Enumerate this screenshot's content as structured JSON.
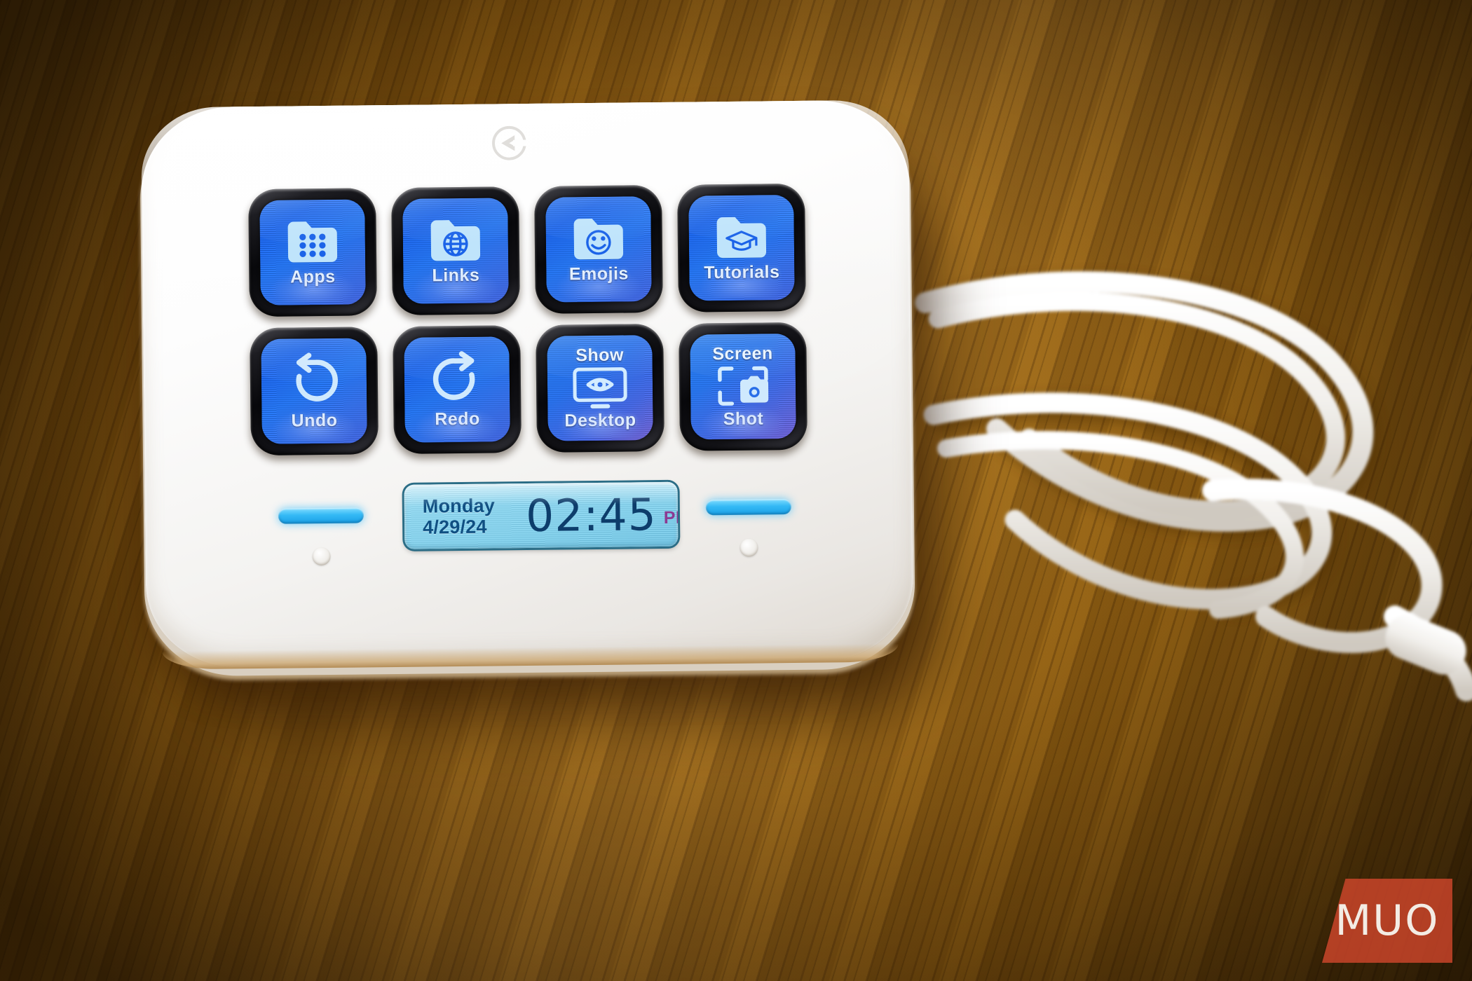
{
  "scene": {
    "description": "Elgato Stream Deck Neo macro pad on a wooden desk",
    "background_color": "#9a6512",
    "device_body_color": "#fdfdfd"
  },
  "device": {
    "brand_logo": "elgato-circle-logo",
    "keys": [
      {
        "id": "apps",
        "label_top": "",
        "label_bottom": "Apps",
        "icon": "folder-apps-grid-icon",
        "screen_color": "#1f74f8"
      },
      {
        "id": "links",
        "label_top": "",
        "label_bottom": "Links",
        "icon": "folder-globe-icon",
        "screen_color": "#1f74f8"
      },
      {
        "id": "emojis",
        "label_top": "",
        "label_bottom": "Emojis",
        "icon": "folder-smiley-icon",
        "screen_color": "#1f74f8"
      },
      {
        "id": "tutorials",
        "label_top": "",
        "label_bottom": "Tutorials",
        "icon": "folder-graduation-cap-icon",
        "screen_color": "#1f74f8"
      },
      {
        "id": "undo",
        "label_top": "",
        "label_bottom": "Undo",
        "icon": "undo-arrow-icon",
        "screen_color": "#1f6ff4"
      },
      {
        "id": "redo",
        "label_top": "",
        "label_bottom": "Redo",
        "icon": "redo-arrow-icon",
        "screen_color": "#1f6ff4"
      },
      {
        "id": "show-desktop",
        "label_top": "Show",
        "label_bottom": "Desktop",
        "icon": "monitor-eye-icon",
        "screen_color": "#2f6ff0"
      },
      {
        "id": "screen-shot",
        "label_top": "Screen",
        "label_bottom": "Shot",
        "icon": "screenshot-camera-icon",
        "screen_color": "#3f68ea"
      }
    ],
    "clock": {
      "day": "Monday",
      "date": "4/29/24",
      "time": "02:45",
      "meridiem": "PM",
      "screen_color": "#8fd9f2",
      "text_color": "#0d3d6b",
      "meridiem_color": "#8c3a92"
    },
    "indicators": {
      "left_led": "led-bar-left",
      "right_led": "led-bar-right",
      "led_color": "#34b9f5"
    },
    "feet": [
      "rubber-foot-left",
      "rubber-foot-right"
    ]
  },
  "accessories": {
    "cable": "coiled-white-braided-usb-cable"
  },
  "watermark": {
    "text": "MUO",
    "background_color": "#d6482d",
    "text_color": "#f3ece4"
  }
}
